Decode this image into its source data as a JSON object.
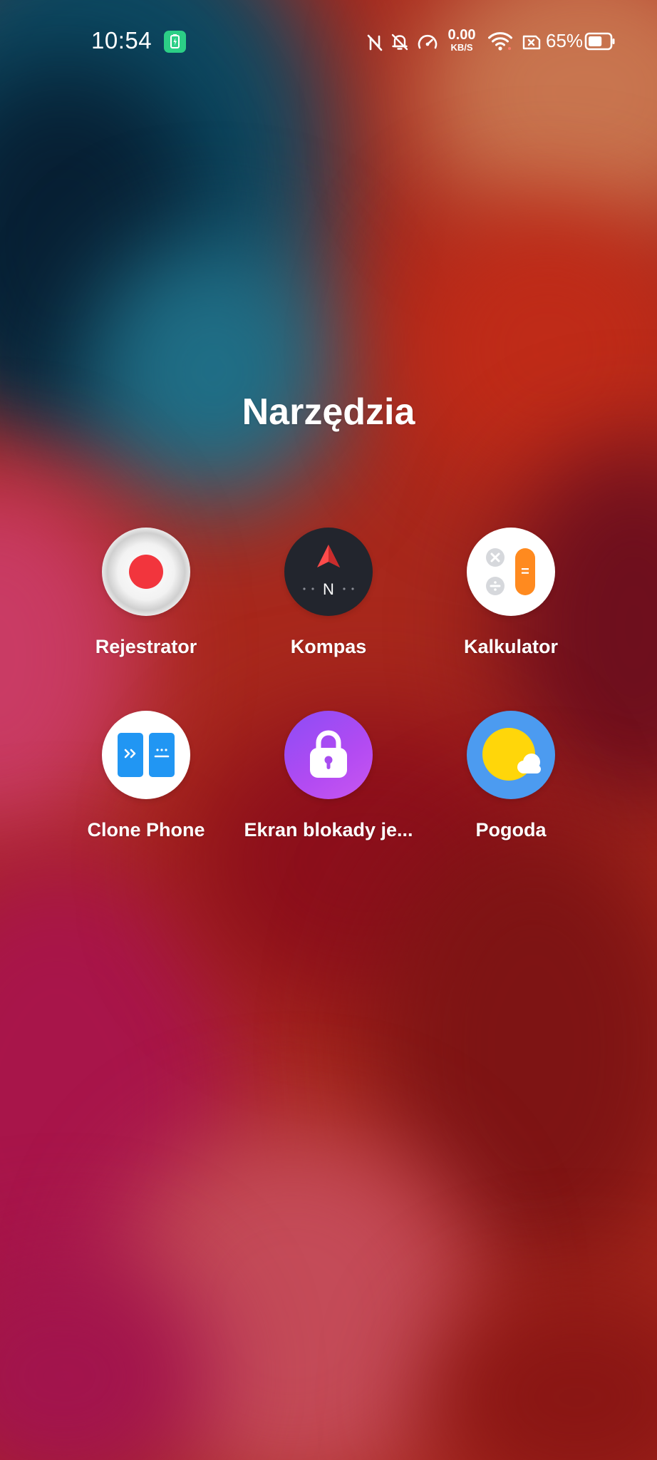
{
  "status_bar": {
    "time": "10:54",
    "battery_saver_icon": "battery-saver-icon",
    "icons": [
      "nfc-off-icon",
      "bell-off-icon",
      "speedometer-icon",
      "wifi-icon",
      "no-sim-icon",
      "battery-icon"
    ],
    "net_speed": {
      "value": "0.00",
      "unit": "KB/S"
    },
    "battery_percent": "65%",
    "battery_level": 0.65
  },
  "folder": {
    "title": "Narzędzia",
    "apps": [
      {
        "label": "Rejestrator",
        "icon": "recorder-icon"
      },
      {
        "label": "Kompas",
        "icon": "compass-icon",
        "icon_text": "N"
      },
      {
        "label": "Kalkulator",
        "icon": "calculator-icon",
        "icon_text": "="
      },
      {
        "label": "Clone Phone",
        "icon": "clone-phone-icon"
      },
      {
        "label": "Ekran blokady je...",
        "icon": "lock-icon"
      },
      {
        "label": "Pogoda",
        "icon": "weather-icon"
      }
    ]
  },
  "colors": {
    "wallpaper_base": "#a8281c",
    "battery_saver": "#2ccf86",
    "recorder_red": "#f2353d",
    "compass_bg": "#22252d",
    "calculator_orange": "#ff8a1f",
    "clone_blue": "#2196f3",
    "lock_purple": "#a84cf0",
    "weather_blue": "#4c9bf0",
    "weather_sun": "#ffd60a"
  }
}
